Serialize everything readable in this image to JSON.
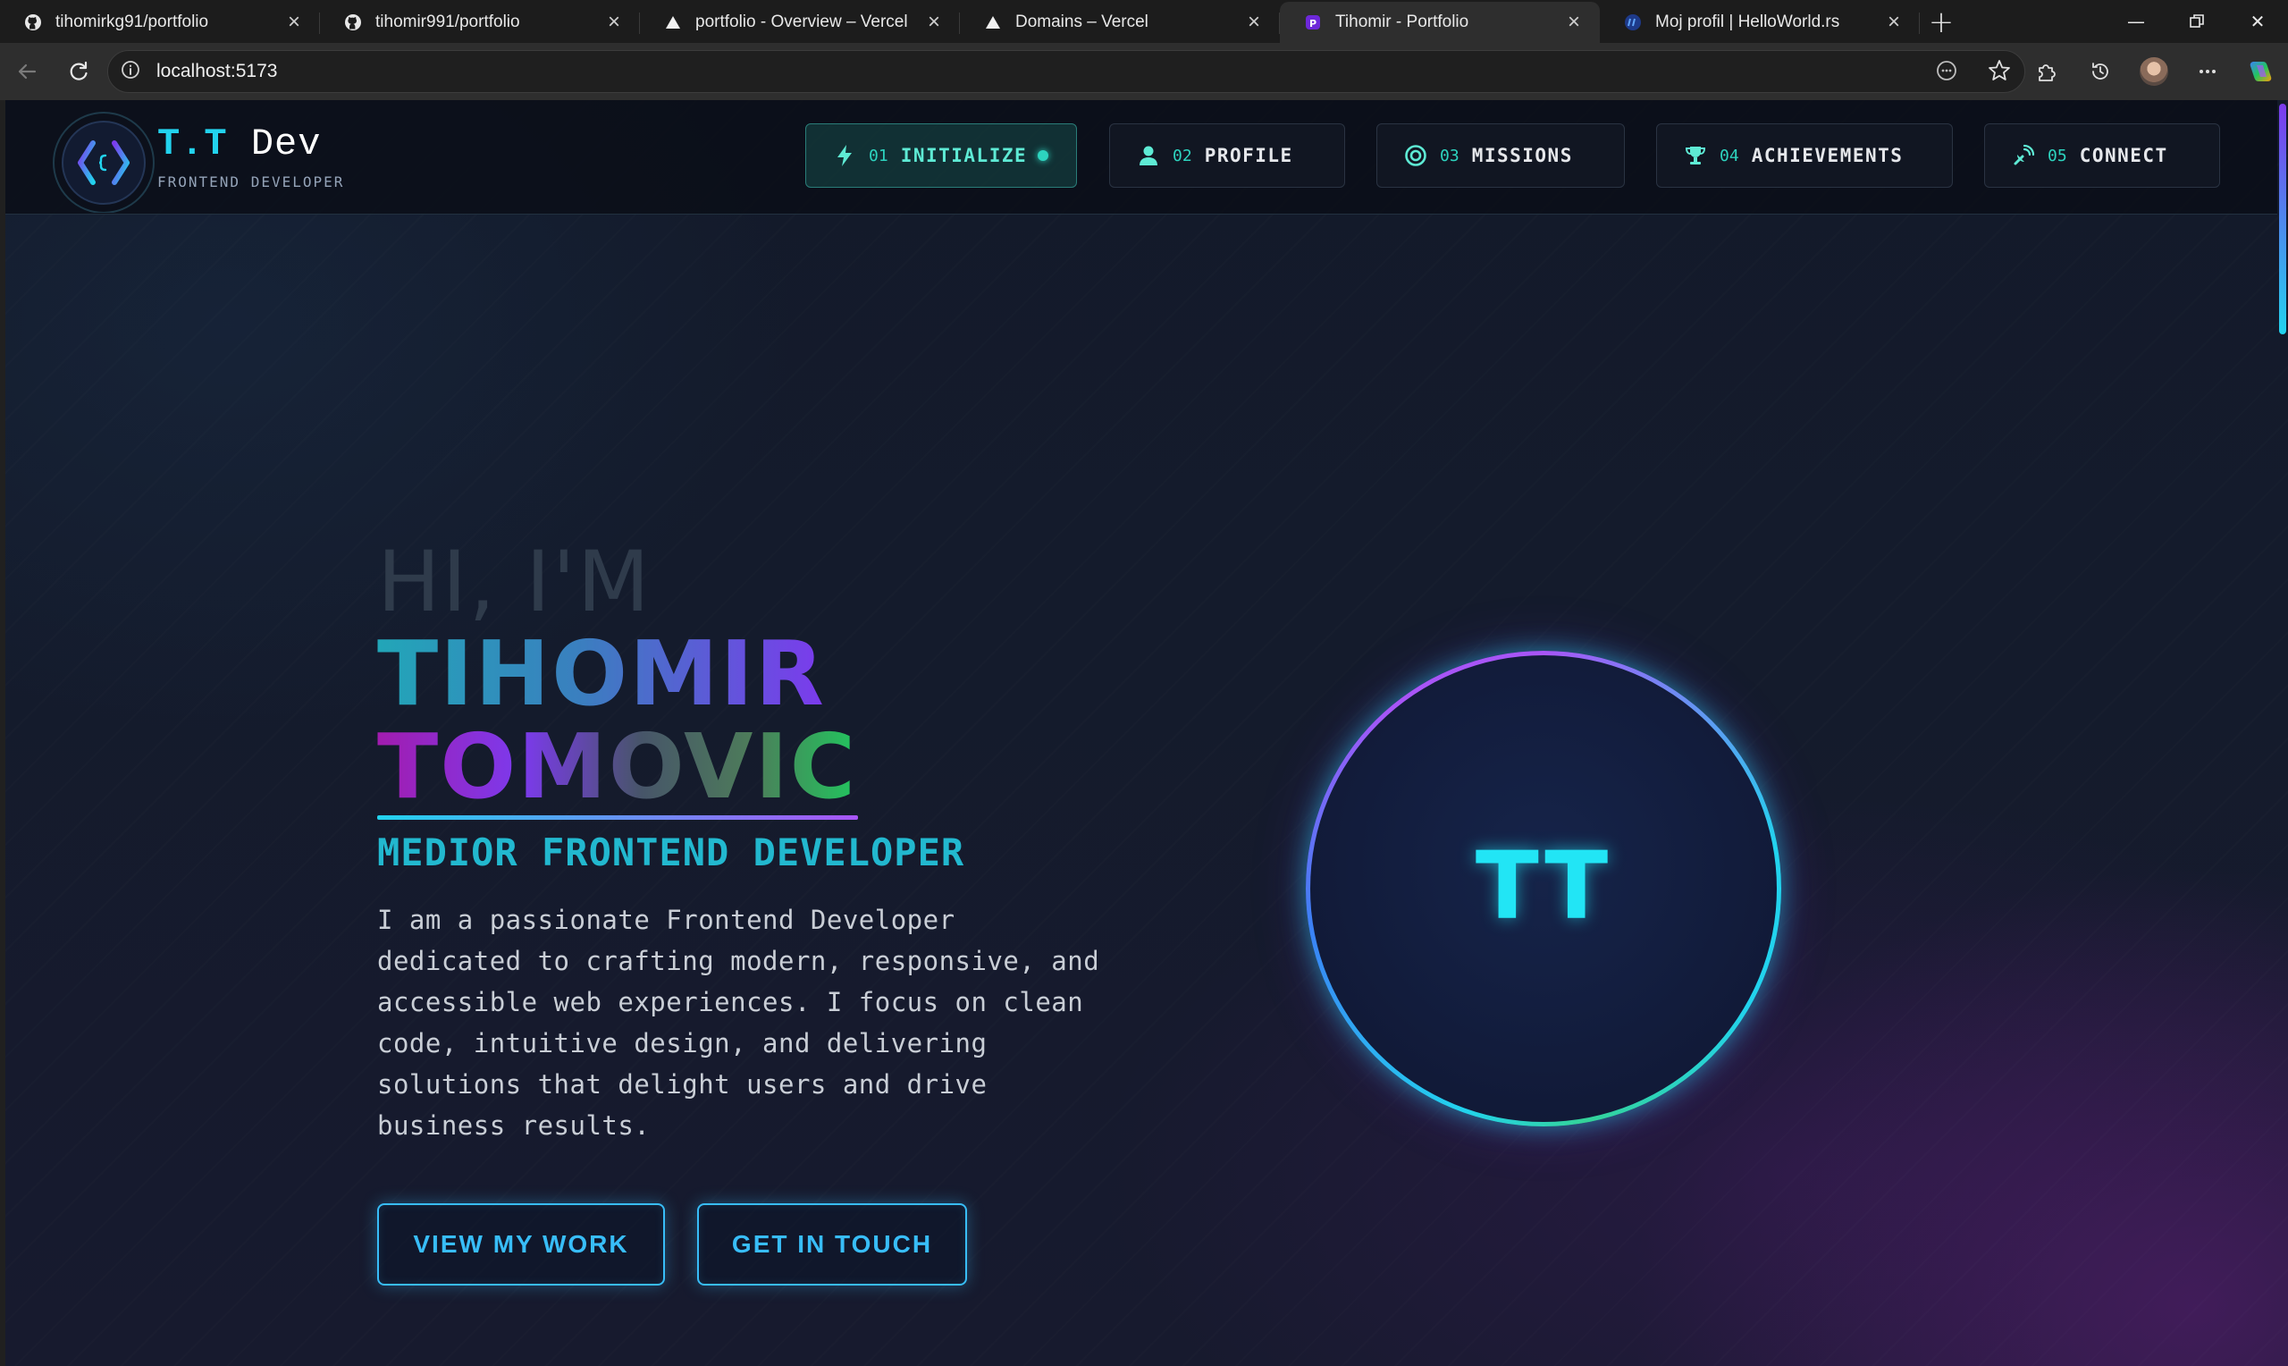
{
  "browser": {
    "tabs": [
      {
        "title": "tihomirkg91/portfolio",
        "icon": "github-icon",
        "active": false
      },
      {
        "title": "tihomir991/portfolio",
        "icon": "github-icon",
        "active": false
      },
      {
        "title": "portfolio - Overview – Vercel",
        "icon": "vercel-icon",
        "active": false
      },
      {
        "title": "Domains – Vercel",
        "icon": "vercel-icon",
        "active": false
      },
      {
        "title": "Tihomir - Portfolio",
        "icon": "site-favicon",
        "active": true
      },
      {
        "title": "Moj profil | HelloWorld.rs",
        "icon": "helloworld-icon",
        "active": false
      }
    ],
    "url": "localhost:5173"
  },
  "site": {
    "logo": {
      "initials": "T.T",
      "dev": "Dev",
      "subtitle": "FRONTEND DEVELOPER"
    },
    "nav": [
      {
        "num": "01",
        "label": "INITIALIZE",
        "icon": "bolt-icon",
        "active": true
      },
      {
        "num": "02",
        "label": "PROFILE",
        "icon": "user-icon",
        "active": false
      },
      {
        "num": "03",
        "label": "MISSIONS",
        "icon": "target-icon",
        "active": false
      },
      {
        "num": "04",
        "label": "ACHIEVEMENTS",
        "icon": "trophy-icon",
        "active": false
      },
      {
        "num": "05",
        "label": "CONNECT",
        "icon": "satellite-icon",
        "active": false
      }
    ]
  },
  "hero": {
    "greeting": "HI, I'M",
    "first_name": "TIHOMIR",
    "last_name": "TOMOVIC",
    "role": "MEDIOR FRONTEND DEVELOPER",
    "bio": "I am a passionate Frontend Developer dedicated to crafting modern, responsive, and accessible web experiences. I focus on clean code, intuitive design, and delivering solutions that delight users and drive business results.",
    "cta_work": "VIEW MY WORK",
    "cta_touch": "GET IN TOUCH",
    "avatar_initials": "TT"
  },
  "colors": {
    "accent": "#22d3ee",
    "purple": "#a855f7",
    "teal": "#2dd4bf",
    "bg": "#141b2c"
  }
}
